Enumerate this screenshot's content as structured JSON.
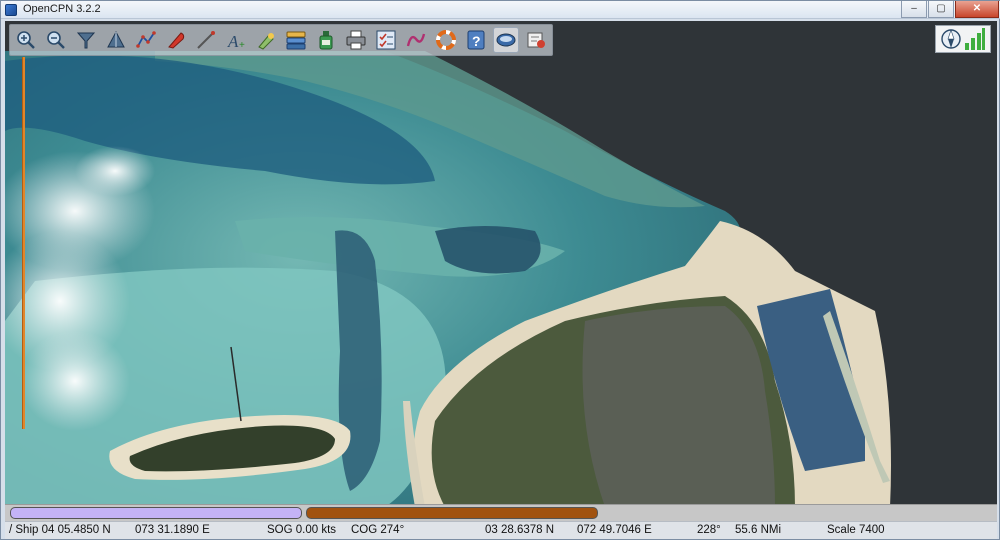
{
  "window": {
    "title": "OpenCPN 3.2.2",
    "controls": {
      "minimize": "–",
      "maximize": "▢",
      "close": "✕"
    }
  },
  "toolbar": {
    "tools": [
      {
        "name": "zoom-in-tool",
        "icon": "zoom-in-icon"
      },
      {
        "name": "zoom-out-tool",
        "icon": "zoom-out-icon"
      },
      {
        "name": "scale-in-tool",
        "icon": "funnel-down-icon"
      },
      {
        "name": "scale-out-tool",
        "icon": "funnel-up-icon"
      },
      {
        "name": "route-tool",
        "icon": "route-icon"
      },
      {
        "name": "auto-follow-tool",
        "icon": "ship-icon"
      },
      {
        "name": "measure-tool",
        "icon": "compass-needle-icon"
      },
      {
        "name": "text-tool",
        "icon": "text-a-icon"
      },
      {
        "name": "light-tool",
        "icon": "light-icon"
      },
      {
        "name": "chart-quilt-tool",
        "icon": "layers-icon"
      },
      {
        "name": "ais-tool",
        "icon": "bottle-icon"
      },
      {
        "name": "print-tool",
        "icon": "printer-icon"
      },
      {
        "name": "route-manager-tool",
        "icon": "checklist-icon"
      },
      {
        "name": "track-tool",
        "icon": "track-icon"
      },
      {
        "name": "mob-tool",
        "icon": "lifebuoy-icon"
      },
      {
        "name": "help-tool",
        "icon": "help-icon"
      },
      {
        "name": "tides-tool",
        "icon": "disc-icon"
      },
      {
        "name": "settings-tool",
        "icon": "settings-icon"
      }
    ]
  },
  "status": {
    "ship": "/ Ship 04 05.4850 N",
    "ship_lon": "073 31.1890 E",
    "sog": "SOG 0.00 kts",
    "cog": "COG 274°",
    "cursor_lat": "03 28.6378 N",
    "cursor_lon": "072 49.7046 E",
    "bearing": "228°",
    "range": "55.6 NMi",
    "scale": "Scale 7400"
  },
  "colors": {
    "deep_water": "#2f3438",
    "lagoon": "#3f8d92",
    "shallow": "#7fc3bd",
    "sand": "#e6ddc6",
    "vegetation": "#3b4b2e",
    "harbor": "#3a5f82",
    "ruler": "#e0862a",
    "piano_key_1": "#c4b3f6",
    "piano_key_2": "#a1520f"
  }
}
